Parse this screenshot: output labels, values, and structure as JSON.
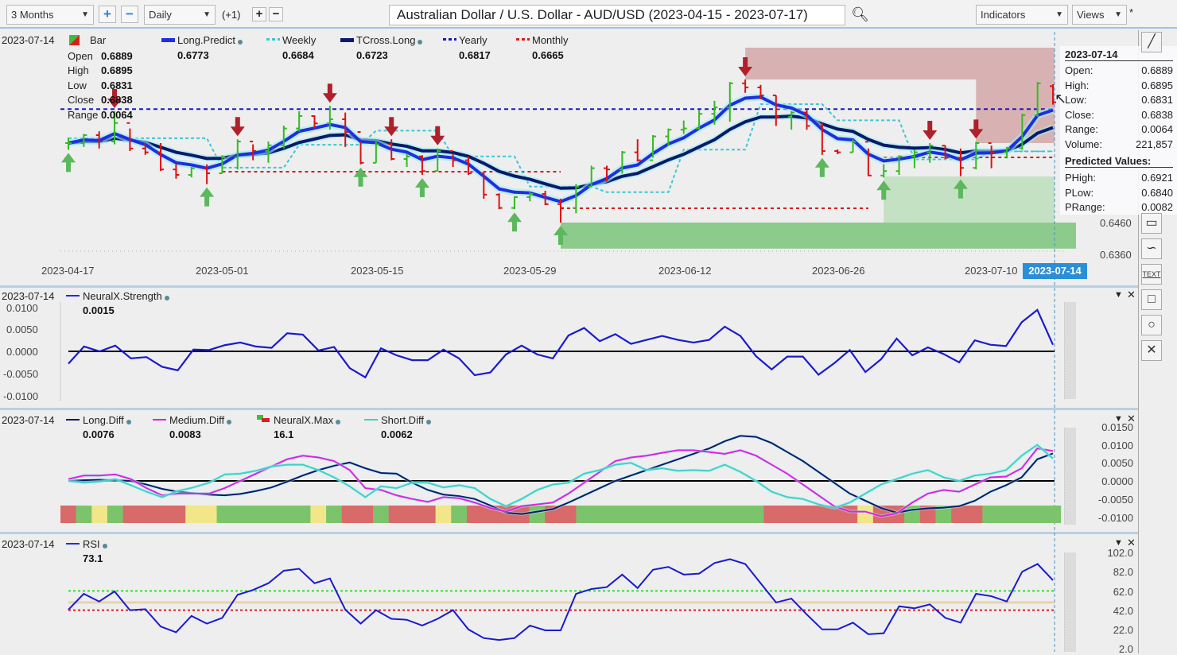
{
  "toolbar": {
    "period": "3 Months",
    "interval": "Daily",
    "offset": "(+1)",
    "title": "Australian Dollar / U.S. Dollar - AUD/USD (2023-04-15 - 2023-07-17)",
    "indicators": "Indicators",
    "views": "Views",
    "modified_marker": "*"
  },
  "main_panel": {
    "date": "2023-07-14",
    "bar_label": "Bar",
    "ohlc": [
      {
        "label": "Open",
        "value": "0.6889"
      },
      {
        "label": "High",
        "value": "0.6895"
      },
      {
        "label": "Low",
        "value": "0.6831"
      },
      {
        "label": "Close",
        "value": "0.6838"
      },
      {
        "label": "Range",
        "value": "0.0064"
      }
    ],
    "legend": [
      {
        "name": "Long.Predict",
        "value": "0.6773",
        "color": "#1e2fe0"
      },
      {
        "name": "Weekly",
        "value": "0.6684",
        "color": "#3cc8d0"
      },
      {
        "name": "TCross.Long",
        "value": "0.6723",
        "color": "#0a1a6a"
      },
      {
        "name": "Yearly",
        "value": "0.6817",
        "color": "#1a1ab0"
      },
      {
        "name": "Monthly",
        "value": "0.6665",
        "color": "#d02020"
      }
    ],
    "y_axis_labels": [
      "0.6460",
      "0.6360"
    ],
    "x_axis_labels": [
      "2023-04-17",
      "2023-05-01",
      "2023-05-15",
      "2023-05-29",
      "2023-06-12",
      "2023-06-26",
      "2023-07-10"
    ],
    "x_axis_current": "2023-07-14",
    "tooltip": {
      "date": "2023-07-14",
      "rows": [
        {
          "label": "Open:",
          "value": "0.6889"
        },
        {
          "label": "High:",
          "value": "0.6895"
        },
        {
          "label": "Low:",
          "value": "0.6831"
        },
        {
          "label": "Close:",
          "value": "0.6838"
        },
        {
          "label": "Range:",
          "value": "0.0064"
        },
        {
          "label": "Volume:",
          "value": "221,857"
        }
      ],
      "predicted_title": "Predicted Values:",
      "predicted": [
        {
          "label": "PHigh:",
          "value": "0.6921"
        },
        {
          "label": "PLow:",
          "value": "0.6840"
        },
        {
          "label": "PRange:",
          "value": "0.0082"
        }
      ]
    }
  },
  "strength_panel": {
    "date": "2023-07-14",
    "name": "NeuralX.Strength",
    "value": "0.0015",
    "y_axis_labels": [
      "0.0100",
      "0.0050",
      "0.0000",
      "-0.0050",
      "-0.0100"
    ]
  },
  "diff_panel": {
    "date": "2023-07-14",
    "legend": [
      {
        "name": "Long.Diff",
        "value": "0.0076",
        "color": "#0a1a6a"
      },
      {
        "name": "Medium.Diff",
        "value": "0.0083",
        "color": "#e020e0"
      },
      {
        "name": "NeuralX.Max",
        "value": "16.1",
        "color": "#d02020"
      },
      {
        "name": "Short.Diff",
        "value": "0.0062",
        "color": "#40d0c8"
      }
    ],
    "y_axis_labels": [
      "0.0150",
      "0.0100",
      "0.0050",
      "0.0000",
      "-0.0050",
      "-0.0100"
    ]
  },
  "rsi_panel": {
    "date": "2023-07-14",
    "name": "RSI",
    "value": "73.1",
    "y_axis_labels": [
      "102.0",
      "82.0",
      "62.0",
      "42.0",
      "22.0",
      "2.0"
    ]
  },
  "right_tools": [
    "line-tool",
    "callout-tool",
    "curve-tool",
    "TEXT",
    "rectangle-tool",
    "ellipse-tool",
    "delete-tool"
  ],
  "chart_data": [
    {
      "type": "ohlc",
      "first_date": "2023-04-17",
      "last_date": "2023-07-14",
      "last_open": 0.6889,
      "high": [
        0.6727,
        0.6739,
        0.6747,
        0.681,
        0.6756,
        0.671,
        0.671,
        0.6643,
        0.6635,
        0.6643,
        0.6672,
        0.6722,
        0.6706,
        0.6715,
        0.6765,
        0.681,
        0.6797,
        0.6827,
        0.6806,
        0.6715,
        0.6715,
        0.6722,
        0.6677,
        0.6672,
        0.6693,
        0.6677,
        0.6668,
        0.6618,
        0.6552,
        0.6543,
        0.6556,
        0.656,
        0.6535,
        0.6581,
        0.6639,
        0.6639,
        0.6685,
        0.6722,
        0.6735,
        0.6756,
        0.6781,
        0.6814,
        0.6843,
        0.6902,
        0.691,
        0.6893,
        0.686,
        0.681,
        0.6814,
        0.6772,
        0.669,
        0.6722,
        0.6693,
        0.6643,
        0.6672,
        0.6689,
        0.671,
        0.6702,
        0.6693,
        0.6714,
        0.6702,
        0.6698,
        0.6802,
        0.6902,
        0.6895
      ],
      "low": [
        0.6689,
        0.6698,
        0.6693,
        0.6706,
        0.6685,
        0.6673,
        0.6622,
        0.6598,
        0.6602,
        0.6581,
        0.6615,
        0.6627,
        0.6656,
        0.6648,
        0.6693,
        0.6747,
        0.6756,
        0.6752,
        0.6698,
        0.6643,
        0.6648,
        0.6656,
        0.6635,
        0.661,
        0.6622,
        0.6635,
        0.661,
        0.6535,
        0.6502,
        0.6502,
        0.6527,
        0.6515,
        0.646,
        0.6489,
        0.6573,
        0.6589,
        0.6614,
        0.6652,
        0.6664,
        0.6702,
        0.6739,
        0.6752,
        0.6768,
        0.6777,
        0.6868,
        0.6848,
        0.6764,
        0.6752,
        0.6752,
        0.6673,
        0.6675,
        0.6681,
        0.6606,
        0.6602,
        0.661,
        0.6631,
        0.6648,
        0.666,
        0.6606,
        0.6627,
        0.6631,
        0.6662,
        0.6689,
        0.6793,
        0.6831
      ],
      "close": [
        0.671,
        0.6735,
        0.6715,
        0.6773,
        0.6693,
        0.6681,
        0.6627,
        0.661,
        0.6631,
        0.6615,
        0.6665,
        0.6715,
        0.6685,
        0.6703,
        0.6756,
        0.6795,
        0.6772,
        0.6785,
        0.6745,
        0.6648,
        0.6706,
        0.666,
        0.6668,
        0.6622,
        0.6685,
        0.6656,
        0.6615,
        0.6548,
        0.6506,
        0.654,
        0.655,
        0.6518,
        0.6506,
        0.6573,
        0.6631,
        0.6627,
        0.6681,
        0.6656,
        0.6731,
        0.6752,
        0.6756,
        0.6802,
        0.6822,
        0.6898,
        0.6885,
        0.686,
        0.6793,
        0.6806,
        0.6764,
        0.6685,
        0.6681,
        0.6714,
        0.6608,
        0.6622,
        0.6668,
        0.6681,
        0.6702,
        0.6664,
        0.6632,
        0.671,
        0.6681,
        0.6694,
        0.6798,
        0.6898,
        0.6838
      ],
      "yearly_level": 0.6817,
      "monthly_levels": [
        {
          "from": "2023-05-01",
          "to": "2023-05-31",
          "value": 0.662
        },
        {
          "from": "2023-05-31",
          "to": "2023-06-28",
          "value": 0.6505
        },
        {
          "from": "2023-06-29",
          "to": "2023-07-14",
          "value": 0.6665
        }
      ],
      "weekly_level": 0.6684,
      "sell_signals": [
        "2023-04-20",
        "2023-05-02",
        "2023-05-10",
        "2023-05-16",
        "2023-05-19",
        "2023-06-16",
        "2023-07-04",
        "2023-07-07"
      ],
      "buy_signals": [
        "2023-04-17",
        "2023-04-28",
        "2023-05-12",
        "2023-05-18",
        "2023-05-26",
        "2023-05-31",
        "2023-06-23",
        "2023-06-29",
        "2023-07-06"
      ],
      "zones": [
        {
          "kind": "resistance",
          "from": "2023-06-16",
          "low": 0.691,
          "high": 0.701,
          "color": "#c98a8a"
        },
        {
          "kind": "resistance",
          "from": "2023-07-07",
          "low": 0.671,
          "high": 0.691,
          "color": "#c98a8a"
        },
        {
          "kind": "support",
          "from": "2023-05-31",
          "low": 0.6378,
          "high": 0.646,
          "color": "#6cbf6c"
        },
        {
          "kind": "support",
          "from": "2023-06-29",
          "low": 0.646,
          "high": 0.6605,
          "color": "#a8d8a8"
        }
      ],
      "y_axis": {
        "ylim": [
          0.636,
          0.701
        ]
      }
    },
    {
      "type": "line",
      "name": "NeuralX.Strength",
      "ylim": [
        -0.01,
        0.01
      ],
      "values": [
        -0.0028,
        0.0011,
        0.0,
        0.0013,
        -0.0016,
        -0.0013,
        -0.0035,
        -0.0043,
        0.0004,
        0.0003,
        0.0014,
        0.002,
        0.0011,
        0.0008,
        0.0041,
        0.0038,
        0.0002,
        0.001,
        -0.0038,
        -0.0059,
        0.0007,
        -0.0009,
        -0.002,
        -0.002,
        0.0004,
        -0.0016,
        -0.0054,
        -0.0048,
        -0.0007,
        0.0013,
        -0.0007,
        -0.0016,
        0.0036,
        0.0053,
        0.0023,
        0.0039,
        0.0017,
        0.0026,
        0.0035,
        0.0026,
        0.002,
        0.0026,
        0.0056,
        0.0035,
        -0.0011,
        -0.0041,
        -0.0012,
        -0.0012,
        -0.0053,
        -0.0027,
        0.0003,
        -0.0047,
        -0.0018,
        0.0029,
        -0.0009,
        0.0009,
        -0.0006,
        -0.0025,
        0.0025,
        0.0015,
        0.0012,
        0.0066,
        0.0094,
        0.0015
      ]
    },
    {
      "type": "line",
      "ylim": [
        -0.01,
        0.015
      ],
      "series": [
        {
          "name": "Long.Diff",
          "values": [
            0.0,
            0.0002,
            0.0003,
            0.0002,
            0.0,
            -0.001,
            -0.0022,
            -0.003,
            -0.0034,
            -0.0038,
            -0.004,
            -0.0036,
            -0.0028,
            -0.0018,
            -0.0002,
            0.0015,
            0.003,
            0.0042,
            0.0051,
            0.0035,
            0.0022,
            0.002,
            -0.0005,
            -0.0025,
            -0.0038,
            -0.0042,
            -0.005,
            -0.0068,
            -0.0088,
            -0.0092,
            -0.0085,
            -0.0078,
            -0.006,
            -0.004,
            -0.002,
            0.0,
            0.0015,
            0.003,
            0.0045,
            0.006,
            0.0075,
            0.009,
            0.011,
            0.0125,
            0.0122,
            0.0105,
            0.008,
            0.0055,
            0.0025,
            -0.0005,
            -0.0035,
            -0.0055,
            -0.0075,
            -0.0088,
            -0.008,
            -0.0076,
            -0.0074,
            -0.007,
            -0.0055,
            -0.003,
            -0.0012,
            0.001,
            0.006,
            0.0076
          ]
        },
        {
          "name": "Medium.Diff",
          "values": [
            0.0005,
            0.0015,
            0.0015,
            0.0018,
            0.0005,
            -0.002,
            -0.004,
            -0.0035,
            -0.0035,
            -0.0035,
            -0.002,
            0.0,
            0.002,
            0.004,
            0.006,
            0.007,
            0.0065,
            0.0055,
            0.003,
            -0.002,
            -0.0025,
            -0.004,
            -0.005,
            -0.0058,
            -0.0045,
            -0.0048,
            -0.006,
            -0.0075,
            -0.0085,
            -0.007,
            -0.0065,
            -0.006,
            -0.0035,
            -0.0005,
            0.0025,
            0.0055,
            0.0065,
            0.007,
            0.0078,
            0.0085,
            0.0085,
            0.008,
            0.0075,
            0.0085,
            0.007,
            0.0045,
            0.002,
            -0.001,
            -0.004,
            -0.007,
            -0.0085,
            -0.0085,
            -0.0098,
            -0.009,
            -0.006,
            -0.0035,
            -0.0025,
            -0.003,
            -0.001,
            0.001,
            0.0012,
            0.0035,
            0.009,
            0.0083
          ]
        },
        {
          "name": "Short.Diff",
          "values": [
            0.0,
            -0.0005,
            -0.0002,
            0.0005,
            -0.0012,
            -0.003,
            -0.0045,
            -0.0028,
            -0.0018,
            -0.0005,
            0.0018,
            0.002,
            0.0028,
            0.004,
            0.0045,
            0.0045,
            0.003,
            0.001,
            -0.0015,
            -0.0045,
            -0.0015,
            -0.002,
            -0.0005,
            -0.0005,
            -0.0018,
            -0.0012,
            -0.002,
            -0.005,
            -0.007,
            -0.005,
            -0.0025,
            -0.001,
            -0.0005,
            0.002,
            0.003,
            0.0045,
            0.005,
            0.003,
            0.0035,
            0.0028,
            0.003,
            0.0028,
            0.0045,
            0.0025,
            0.0,
            -0.003,
            -0.0045,
            -0.005,
            -0.0065,
            -0.0075,
            -0.006,
            -0.0035,
            -0.001,
            0.0005,
            0.002,
            0.003,
            0.001,
            0.0,
            0.0015,
            0.002,
            0.003,
            0.007,
            0.01,
            0.0062
          ]
        }
      ],
      "neuralx_max_states": "RGYGRRRRYYGGGGGGYGRRGRRRYGRRRRGRRGGGGGGGGGGGGRRRRRRYRRGRGRRGGGGG",
      "state_colors": {
        "R": "#d96a6a",
        "G": "#7cc46c",
        "Y": "#f2e68a"
      }
    },
    {
      "type": "line",
      "name": "RSI",
      "ylim": [
        2,
        102
      ],
      "levels": [
        {
          "value": 62,
          "color": "#33dd33"
        },
        {
          "value": 50,
          "color": "#e8c890"
        },
        {
          "value": 42,
          "color": "#dd2020"
        }
      ],
      "values": [
        42.5,
        59,
        51,
        61.5,
        42,
        43,
        25,
        19,
        36,
        28,
        34,
        58,
        63,
        70,
        83,
        85,
        70,
        75,
        42.5,
        28,
        42,
        33,
        32,
        26,
        33,
        42,
        22,
        13,
        11,
        13,
        26,
        21,
        21,
        59,
        64,
        66,
        79,
        65,
        84,
        87,
        79,
        80,
        91,
        95,
        90,
        70,
        50,
        54,
        37.5,
        22,
        22,
        29,
        17,
        18,
        46,
        44,
        48,
        34,
        29,
        59,
        56.5,
        51,
        82,
        90,
        73.1
      ]
    }
  ]
}
